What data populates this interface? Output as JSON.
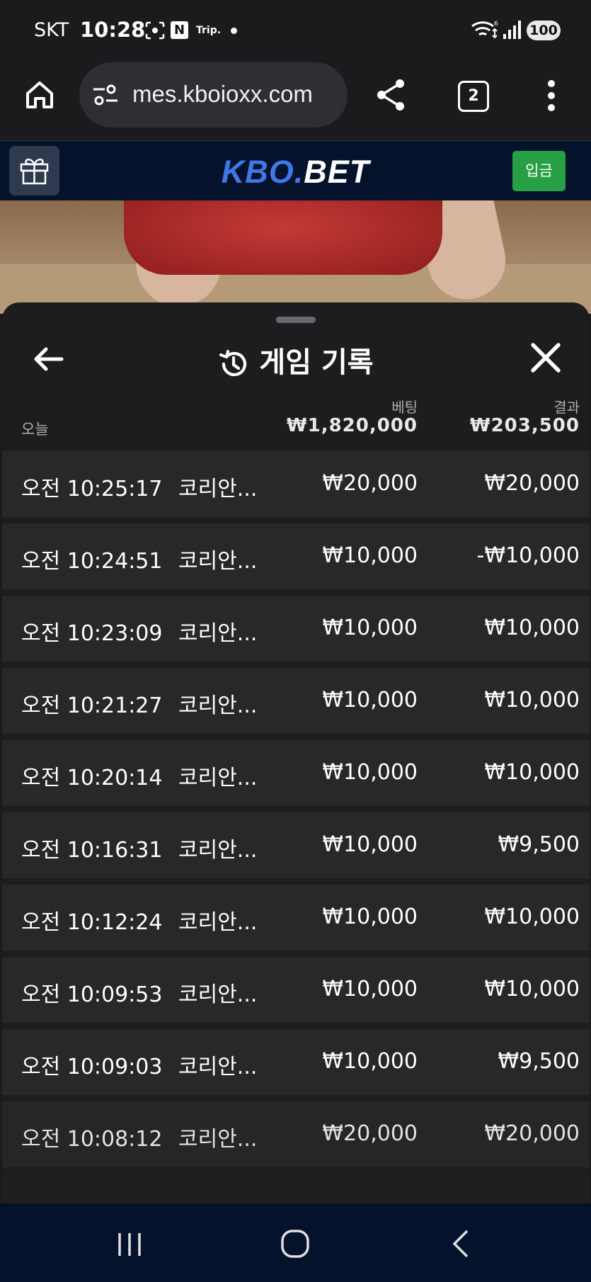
{
  "status_bar": {
    "carrier": "SKT",
    "time": "10:28",
    "notif_n": "N",
    "notif_trip": "Trip.",
    "battery": "100"
  },
  "browser": {
    "url": "mes.kboioxx.com",
    "tab_count": "2"
  },
  "site": {
    "brand_part1": "KBO.",
    "brand_part2": "BET",
    "deposit_label": "입금"
  },
  "panel": {
    "title": "게임 기록",
    "today_label": "오늘",
    "bet_label": "베팅",
    "bet_total": "₩1,820,000",
    "result_label": "결과",
    "result_total": "₩203,500",
    "rows": [
      {
        "time": "오전 10:25:17",
        "game": "코리안...",
        "bet": "₩20,000",
        "result": "₩20,000"
      },
      {
        "time": "오전 10:24:51",
        "game": "코리안...",
        "bet": "₩10,000",
        "result": "-₩10,000"
      },
      {
        "time": "오전 10:23:09",
        "game": "코리안...",
        "bet": "₩10,000",
        "result": "₩10,000"
      },
      {
        "time": "오전 10:21:27",
        "game": "코리안...",
        "bet": "₩10,000",
        "result": "₩10,000"
      },
      {
        "time": "오전 10:20:14",
        "game": "코리안...",
        "bet": "₩10,000",
        "result": "₩10,000"
      },
      {
        "time": "오전 10:16:31",
        "game": "코리안...",
        "bet": "₩10,000",
        "result": "₩9,500"
      },
      {
        "time": "오전 10:12:24",
        "game": "코리안...",
        "bet": "₩10,000",
        "result": "₩10,000"
      },
      {
        "time": "오전 10:09:53",
        "game": "코리안...",
        "bet": "₩10,000",
        "result": "₩10,000"
      },
      {
        "time": "오전 10:09:03",
        "game": "코리안...",
        "bet": "₩10,000",
        "result": "₩9,500"
      },
      {
        "time": "오전 10:08:12",
        "game": "코리안...",
        "bet": "₩20,000",
        "result": "₩20,000"
      }
    ]
  },
  "colors": {
    "panel_bg": "#1d1d1f",
    "row_bg": "#28282a",
    "header_bg": "#04122c",
    "brand_blue": "#3f78e6",
    "deposit_green": "#27a045"
  },
  "icons": {
    "home": "home-icon",
    "site_settings": "site-settings-icon",
    "share": "share-icon",
    "menu": "more-vert-icon",
    "gift": "gift-icon",
    "back": "arrow-left-icon",
    "history": "history-icon",
    "close": "close-icon"
  }
}
